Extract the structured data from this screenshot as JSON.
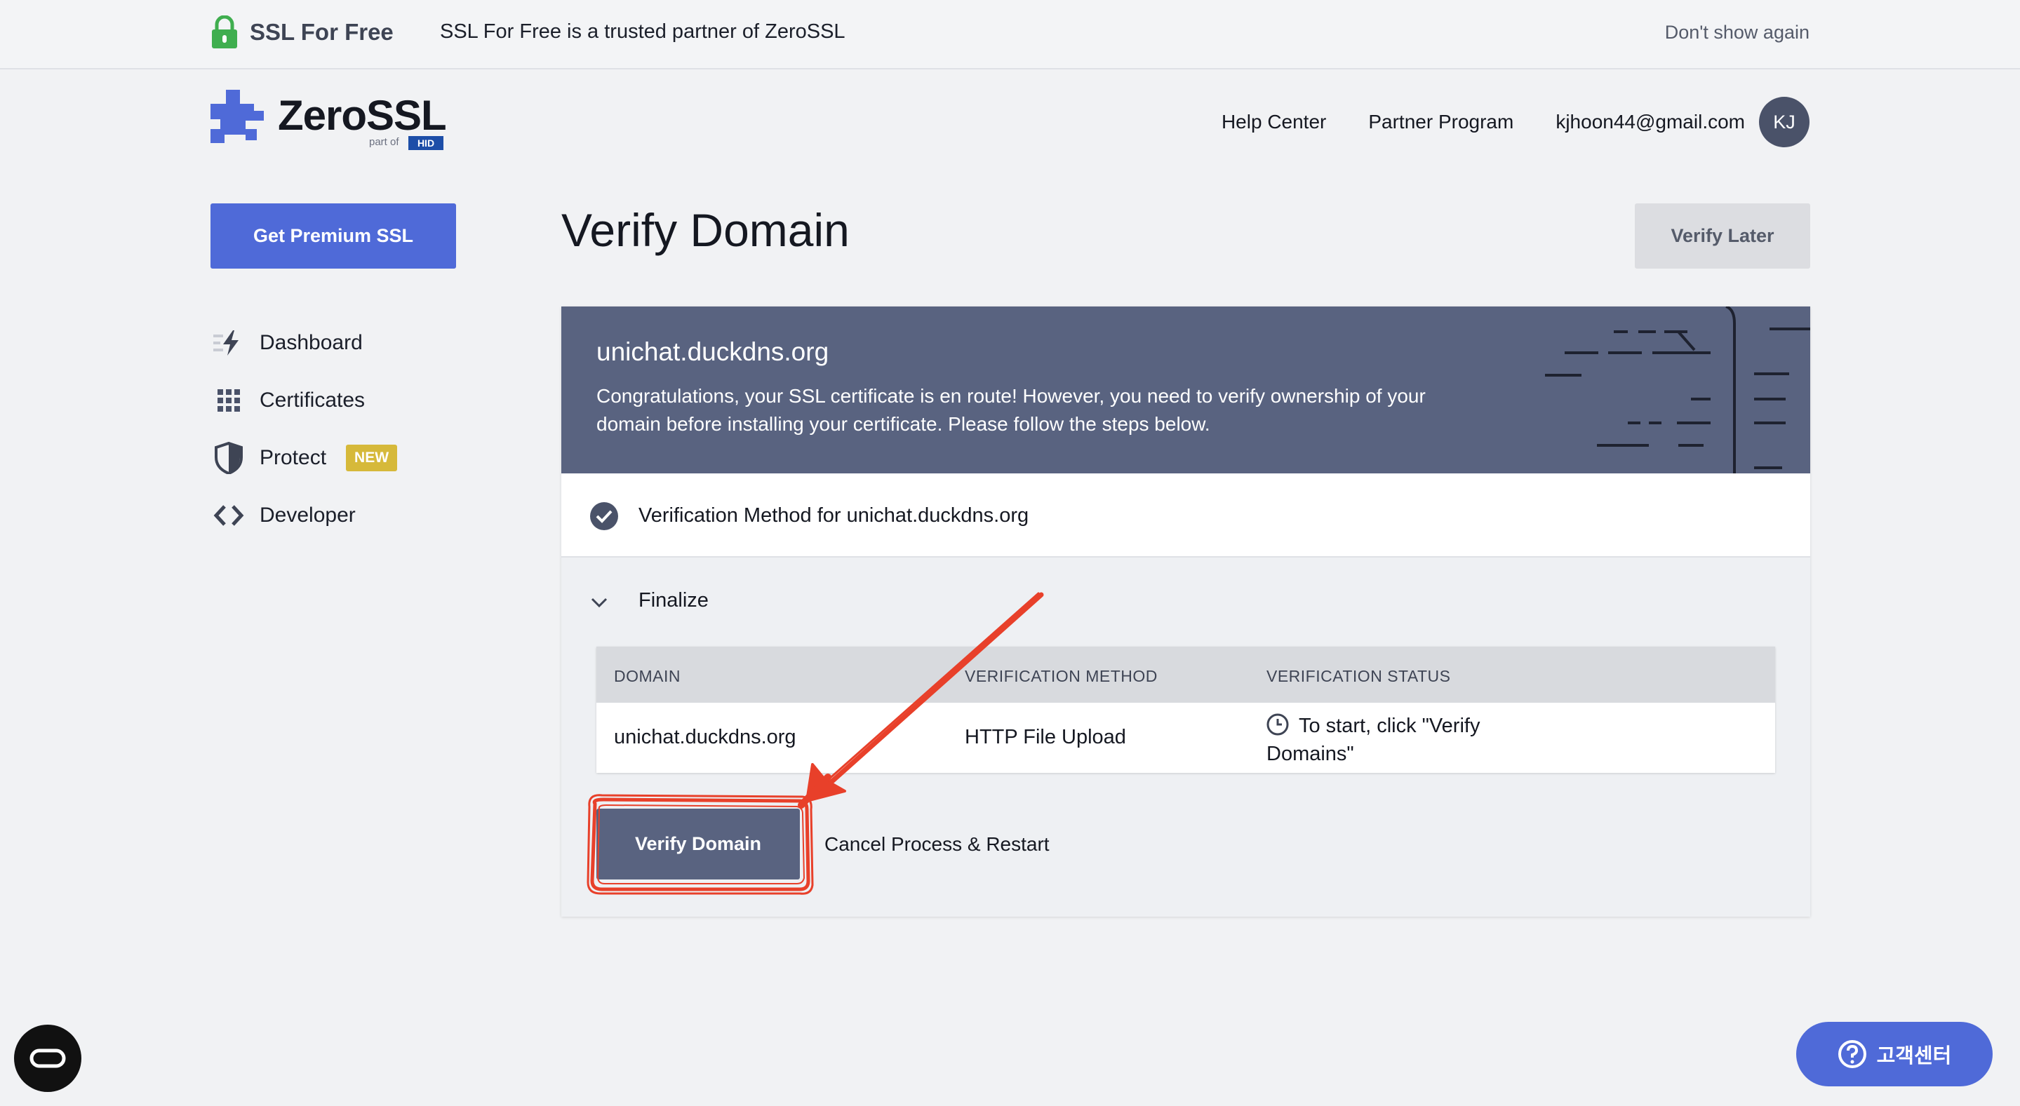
{
  "topbar": {
    "brand": "SSL For Free",
    "partner_text": "SSL For Free is a trusted partner of ZeroSSL",
    "dismiss": "Don't show again"
  },
  "header": {
    "logo_text": "ZeroSSL",
    "logo_partof": "part of",
    "logo_hid": "HID",
    "nav": [
      "Help Center",
      "Partner Program"
    ],
    "email": "kjhoon44@gmail.com",
    "avatar_initials": "KJ"
  },
  "sidebar": {
    "premium_button": "Get Premium SSL",
    "items": [
      {
        "label": "Dashboard",
        "icon": "lightning-icon"
      },
      {
        "label": "Certificates",
        "icon": "grid-dots-icon"
      },
      {
        "label": "Protect",
        "icon": "shield-icon",
        "badge": "NEW"
      },
      {
        "label": "Developer",
        "icon": "code-brackets-icon"
      }
    ]
  },
  "main": {
    "title": "Verify Domain",
    "verify_later": "Verify Later",
    "banner": {
      "domain": "unichat.duckdns.org",
      "message": "Congratulations, your SSL certificate is en route! However, you need to verify ownership of your domain before installing your certificate. Please follow the steps below."
    },
    "step_completed": "Verification Method for unichat.duckdns.org",
    "step_current": "Finalize",
    "table": {
      "headers": [
        "DOMAIN",
        "VERIFICATION METHOD",
        "VERIFICATION STATUS"
      ],
      "row": {
        "domain": "unichat.duckdns.org",
        "method": "HTTP File Upload",
        "status": "To start, click \"Verify Domains\""
      }
    },
    "verify_button": "Verify Domain",
    "cancel_link": "Cancel Process & Restart"
  },
  "support_button": "고객센터",
  "colors": {
    "accent": "#4f6ad8",
    "banner": "#596380",
    "badge": "#d6b93a",
    "annotation": "#e8402a"
  }
}
